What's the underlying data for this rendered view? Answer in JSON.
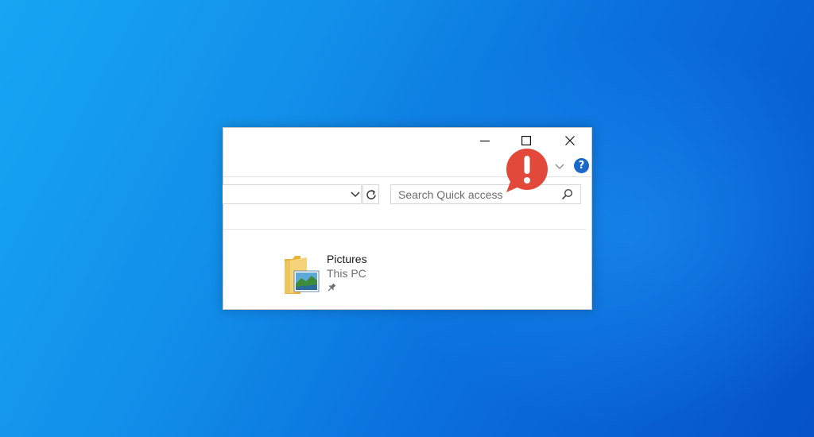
{
  "window": {
    "caption_buttons": {
      "minimize": "minimize-icon",
      "maximize": "maximize-icon",
      "close": "close-icon"
    },
    "ribbon": {
      "expand_icon": "chevron-down-icon",
      "help_glyph": "?"
    }
  },
  "search": {
    "placeholder": "Search Quick access",
    "value": ""
  },
  "content": {
    "items": [
      {
        "name": "Pictures",
        "location": "This PC",
        "icon": "pictures-folder-icon",
        "pinned": true
      }
    ]
  },
  "overlay": {
    "alert_icon": "exclamation-alert-icon",
    "alert_color": "#e2493a"
  },
  "colors": {
    "desktop_gradient_start": "#17a6f3",
    "desktop_gradient_end": "#0652c8",
    "help_icon_blue": "#1a68c7"
  }
}
